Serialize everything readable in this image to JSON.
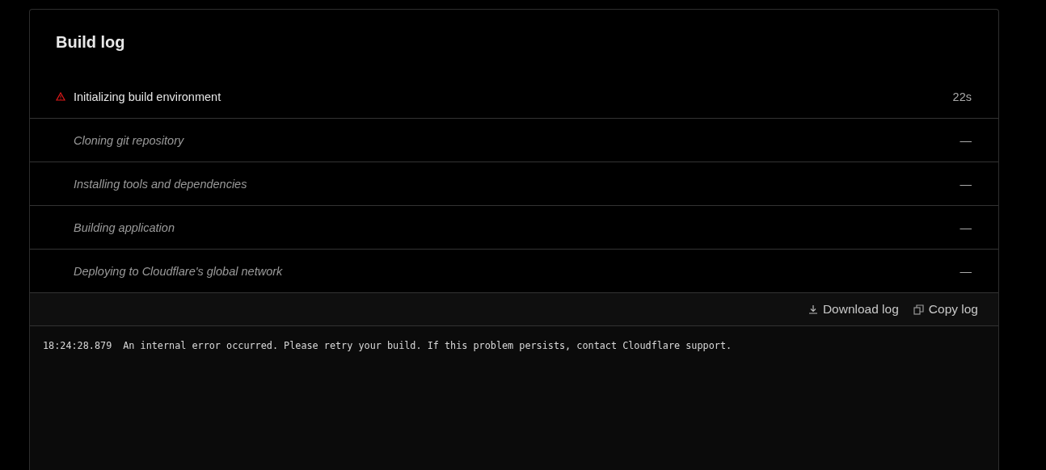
{
  "title": "Build log",
  "steps": [
    {
      "label": "Initializing build environment",
      "kind": "error",
      "duration": "22s"
    },
    {
      "label": "Cloning git repository",
      "kind": "pending",
      "duration": "—"
    },
    {
      "label": "Installing tools and dependencies",
      "kind": "pending",
      "duration": "—"
    },
    {
      "label": "Building application",
      "kind": "pending",
      "duration": "—"
    },
    {
      "label": "Deploying to Cloudflare's global network",
      "kind": "pending",
      "duration": "—"
    }
  ],
  "actions": [
    {
      "kind": "download",
      "label": "Download log"
    },
    {
      "kind": "copy",
      "label": "Copy log"
    }
  ],
  "log": [
    {
      "time": "18:24:28.879",
      "message": "An internal error occurred. Please retry your build. If this problem persists, contact Cloudflare support."
    }
  ]
}
